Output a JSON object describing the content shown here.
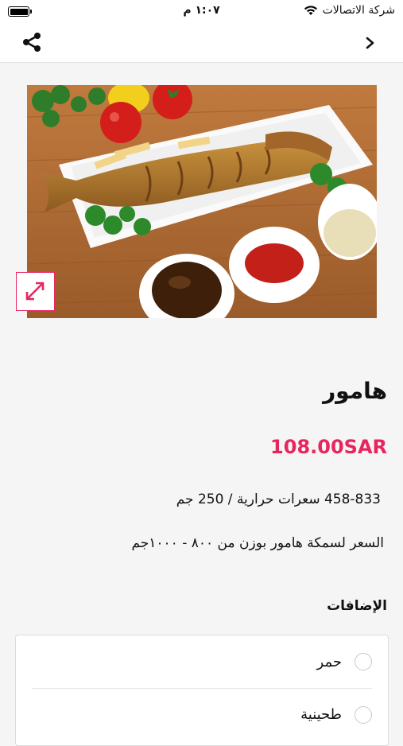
{
  "status_bar": {
    "carrier": "شركة الاتصالات",
    "time": "١:٠٧ م",
    "battery_level": 1.0
  },
  "nav": {
    "share_icon": "share-icon",
    "back_icon": "chevron-right-icon"
  },
  "product": {
    "image_alt": "fried fish dish",
    "expand_icon": "expand-icon",
    "name": "هامور",
    "price": "108.00SAR",
    "calories": "458-833 سعرات حرارية / 250 جم",
    "description": "السعر لسمكة هامور بوزن من ٨٠٠ - ١٠٠٠جم"
  },
  "addons": {
    "title": "الإضافات",
    "items": [
      {
        "label": "حمر",
        "selected": false
      },
      {
        "label": "طحينية",
        "selected": false
      }
    ]
  },
  "colors": {
    "accent": "#e8265e",
    "background": "#f5f5f5"
  }
}
